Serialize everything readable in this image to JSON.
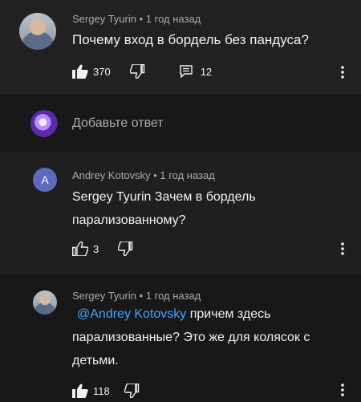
{
  "top_comment": {
    "author": "Sergey Tyurin",
    "separator": "•",
    "time": "1 год назад",
    "text": "Почему вход в бордель без пандуса?",
    "likes": "370",
    "replies": "12"
  },
  "reply_box": {
    "placeholder": "Добавьте ответ"
  },
  "replies": [
    {
      "avatar_letter": "A",
      "author": "Andrey Kotovsky",
      "separator": "•",
      "time": "1 год назад",
      "text_line1": "Sergey Tyurin Зачем в бордель",
      "text_line2": "парализованному?",
      "likes": "3"
    },
    {
      "author": "Sergey Tyurin",
      "separator": "•",
      "time": "1 год назад",
      "mention": "@Andrey Kotovsky",
      "text_line1_rest": " причем здесь",
      "text_line2": "парализованные? Это же для колясок с",
      "text_line3": "детьми.",
      "likes": "118"
    }
  ],
  "colors": {
    "accent": "#3ea6ff",
    "letter_avatar": "#5c6bc0"
  }
}
